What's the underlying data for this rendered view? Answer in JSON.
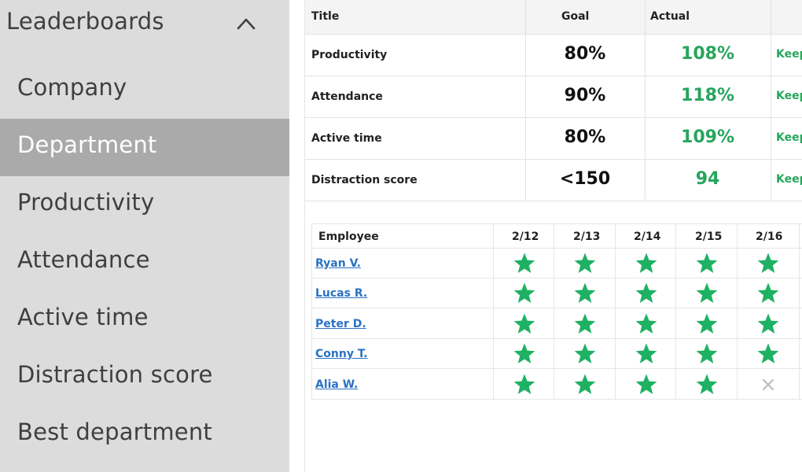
{
  "sidebar": {
    "title": "Leaderboards",
    "items": [
      {
        "label": "Company",
        "active": false
      },
      {
        "label": "Department",
        "active": true
      },
      {
        "label": "Productivity",
        "active": false
      },
      {
        "label": "Attendance",
        "active": false
      },
      {
        "label": "Active time",
        "active": false
      },
      {
        "label": "Distraction score",
        "active": false
      },
      {
        "label": "Best department",
        "active": false
      }
    ]
  },
  "goals_table": {
    "headers": {
      "title": "Title",
      "goal": "Goal",
      "actual": "Actual"
    },
    "rows": [
      {
        "title": "Productivity",
        "goal": "80%",
        "actual": "108%",
        "status": "Keep"
      },
      {
        "title": "Attendance",
        "goal": "90%",
        "actual": "118%",
        "status": "Keep"
      },
      {
        "title": "Active time",
        "goal": "80%",
        "actual": "109%",
        "status": "Keep"
      },
      {
        "title": "Distraction score",
        "goal": "<150",
        "actual": "94",
        "status": "Keep"
      }
    ]
  },
  "streak_table": {
    "headers": {
      "employee": "Employee",
      "dates": [
        "2/12",
        "2/13",
        "2/14",
        "2/15",
        "2/16"
      ]
    },
    "rows": [
      {
        "name": "Ryan V.",
        "marks": [
          "star-icon",
          "star-icon",
          "star-icon",
          "star-icon",
          "star-icon"
        ]
      },
      {
        "name": "Lucas R.",
        "marks": [
          "star-icon",
          "star-icon",
          "star-icon",
          "star-icon",
          "star-icon"
        ]
      },
      {
        "name": "Peter D.",
        "marks": [
          "star-icon",
          "star-icon",
          "star-icon",
          "star-icon",
          "star-icon"
        ]
      },
      {
        "name": "Conny T.",
        "marks": [
          "star-icon",
          "star-icon",
          "star-icon",
          "star-icon",
          "star-icon"
        ]
      },
      {
        "name": "Alia W.",
        "marks": [
          "star-icon",
          "star-icon",
          "star-icon",
          "star-icon",
          "x-icon"
        ]
      }
    ]
  },
  "colors": {
    "accent_green": "#27a55c",
    "star_green": "#1fb163",
    "link_blue": "#2a72c4",
    "sidebar_bg": "#dcdcdc",
    "sidebar_active_bg": "#aaaaaa"
  }
}
